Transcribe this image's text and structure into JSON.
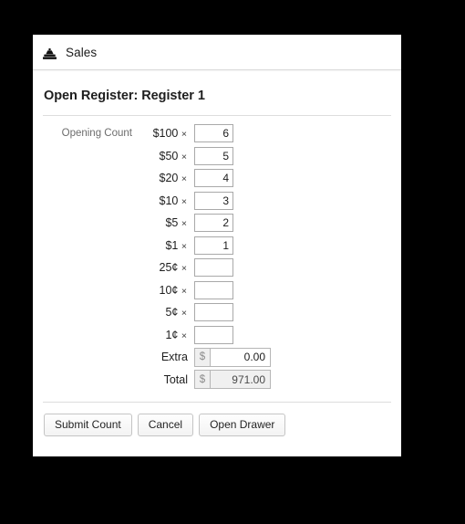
{
  "frame": {
    "background_color": "#000000"
  },
  "top_bar": {
    "icon": "cash-register-icon",
    "title": "Sales"
  },
  "page": {
    "title": "Open Register: Register 1"
  },
  "form": {
    "group_label": "Opening Count",
    "multiply_symbol": "×",
    "currency_symbol": "$",
    "denominations": [
      {
        "label": "$100",
        "value": "6"
      },
      {
        "label": "$50",
        "value": "5"
      },
      {
        "label": "$20",
        "value": "4"
      },
      {
        "label": "$10",
        "value": "3"
      },
      {
        "label": "$5",
        "value": "2"
      },
      {
        "label": "$1",
        "value": "1"
      },
      {
        "label": "25¢",
        "value": ""
      },
      {
        "label": "10¢",
        "value": ""
      },
      {
        "label": "5¢",
        "value": ""
      },
      {
        "label": "1¢",
        "value": ""
      }
    ],
    "extra": {
      "label": "Extra",
      "prefix": "$",
      "value": "0.00"
    },
    "total": {
      "label": "Total",
      "prefix": "$",
      "value": "971.00"
    }
  },
  "buttons": {
    "submit": "Submit Count",
    "cancel": "Cancel",
    "open_drawer": "Open Drawer"
  },
  "colors": {
    "frame": "#000000",
    "panel": "#ffffff",
    "divider": "#dddddd",
    "label_muted": "#6c6c6c",
    "text": "#1e1e1e",
    "input_border": "#a9a9a9",
    "addon_bg": "#efefef",
    "readonly_bg": "#f0f0f0"
  }
}
